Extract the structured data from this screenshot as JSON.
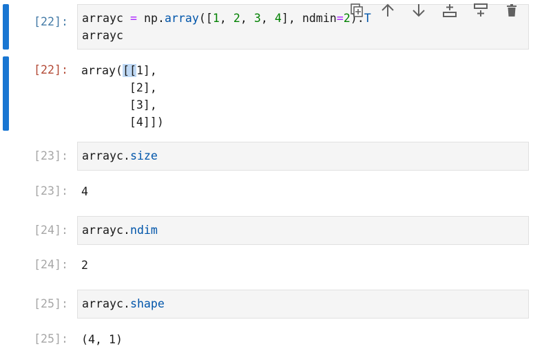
{
  "toolbar": {
    "icons": [
      "duplicate-cell-icon",
      "move-up-icon",
      "move-down-icon",
      "insert-cell-above-icon",
      "insert-cell-below-icon",
      "delete-cell-icon"
    ]
  },
  "cells": {
    "c22": {
      "in_prompt": "[22]:",
      "out_prompt": "[22]:",
      "line1": {
        "arrayc": "arrayc",
        "eq": "=",
        "np": "np",
        "dot": ".",
        "array": "array",
        "open": "([",
        "n1": "1",
        "c1": ", ",
        "n2": "2",
        "c2": ", ",
        "n3": "3",
        "c3": ", ",
        "n4": "4",
        "close": "], ",
        "ndmin": "ndmin",
        "eq2": "=",
        "n5": "2",
        "close2": ").",
        "T": "T"
      },
      "line2": "arrayc",
      "output": {
        "pre": "array(",
        "hl": "[[",
        "l1": "1],",
        "l2": "       [2],",
        "l3": "       [3],",
        "l4": "       [4]])"
      }
    },
    "c23": {
      "in_prompt": "[23]:",
      "obj": "arrayc",
      "dot": ".",
      "attr": "size",
      "out_prompt": "[23]:",
      "output": "4"
    },
    "c24": {
      "in_prompt": "[24]:",
      "obj": "arrayc",
      "dot": ".",
      "attr": "ndim",
      "out_prompt": "[24]:",
      "output": "2"
    },
    "c25": {
      "in_prompt": "[25]:",
      "obj": "arrayc",
      "dot": ".",
      "attr": "shape",
      "out_prompt": "[25]:",
      "output": "(4, 1)"
    }
  }
}
